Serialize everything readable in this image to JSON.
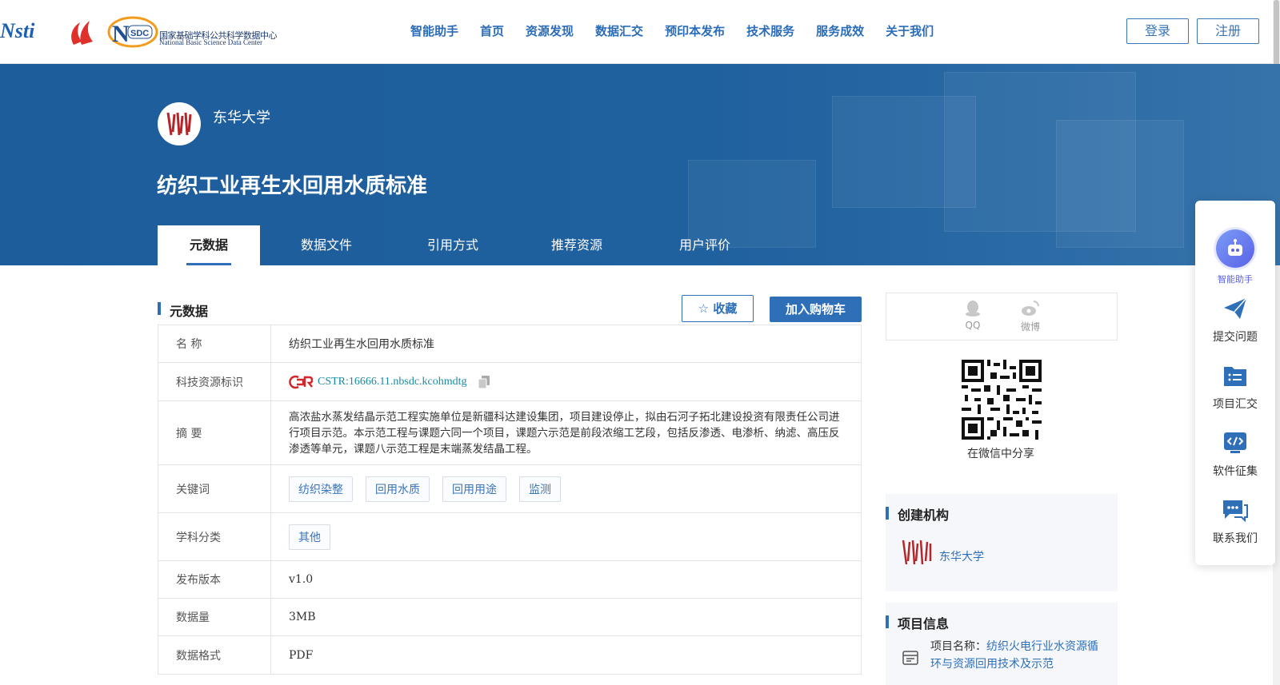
{
  "header": {
    "logo_cstr_text": "Nsti",
    "logo_nsdc_cn": "国家基础学科公共科学数据中心",
    "logo_nsdc_en": "National Basic Science Data Center",
    "nav": [
      "智能助手",
      "首页",
      "资源发现",
      "数据汇交",
      "预印本发布",
      "技术服务",
      "服务成效",
      "关于我们"
    ],
    "login": "登录",
    "register": "注册"
  },
  "banner": {
    "institution": "东华大学",
    "title": "纺织工业再生水回用水质标准",
    "tabs": [
      "元数据",
      "数据文件",
      "引用方式",
      "推荐资源",
      "用户评价"
    ],
    "active_tab": 0
  },
  "metadata": {
    "section_title": "元数据",
    "favorite": "收藏",
    "add_cart": "加入购物车",
    "rows": {
      "name_label": "名 称",
      "name_value": "纺织工业再生水回用水质标准",
      "id_label": "科技资源标识",
      "id_value": "CSTR:16666.11.nbsdc.kcohmdtg",
      "summary_label": "摘 要",
      "summary_value": "高浓盐水蒸发结晶示范工程实施单位是新疆科达建设集团，项目建设停止，拟由石河子拓北建设投资有限责任公司进行项目示范。本示范工程与课题六同一个项目，课题六示范是前段浓缩工艺段，包括反渗透、电渗析、纳滤、高压反渗透等单元，课题八示范工程是末端蒸发结晶工程。",
      "keywords_label": "关键词",
      "keywords": [
        "纺织染整",
        "回用水质",
        "回用用途",
        "监测"
      ],
      "subject_label": "学科分类",
      "subject": "其他",
      "version_label": "发布版本",
      "version_value": "v1.0",
      "size_label": "数据量",
      "size_value": "3MB",
      "format_label": "数据格式",
      "format_value": "PDF"
    }
  },
  "sidebar": {
    "share_qq": "QQ",
    "share_weibo": "微博",
    "qr_label": "在微信中分享",
    "org_title": "创建机构",
    "org_name": "东华大学",
    "project_title": "项目信息",
    "project_label": "项目名称：",
    "project_name": "纺织火电行业水资源循环与资源回用技术及示范"
  },
  "float_panel": {
    "items": [
      "智能助手",
      "提交问题",
      "项目汇交",
      "软件征集",
      "联系我们"
    ]
  },
  "colors": {
    "primary": "#2e6fb8",
    "banner": "#1f609e",
    "ai_accent": "#5a62e8"
  }
}
